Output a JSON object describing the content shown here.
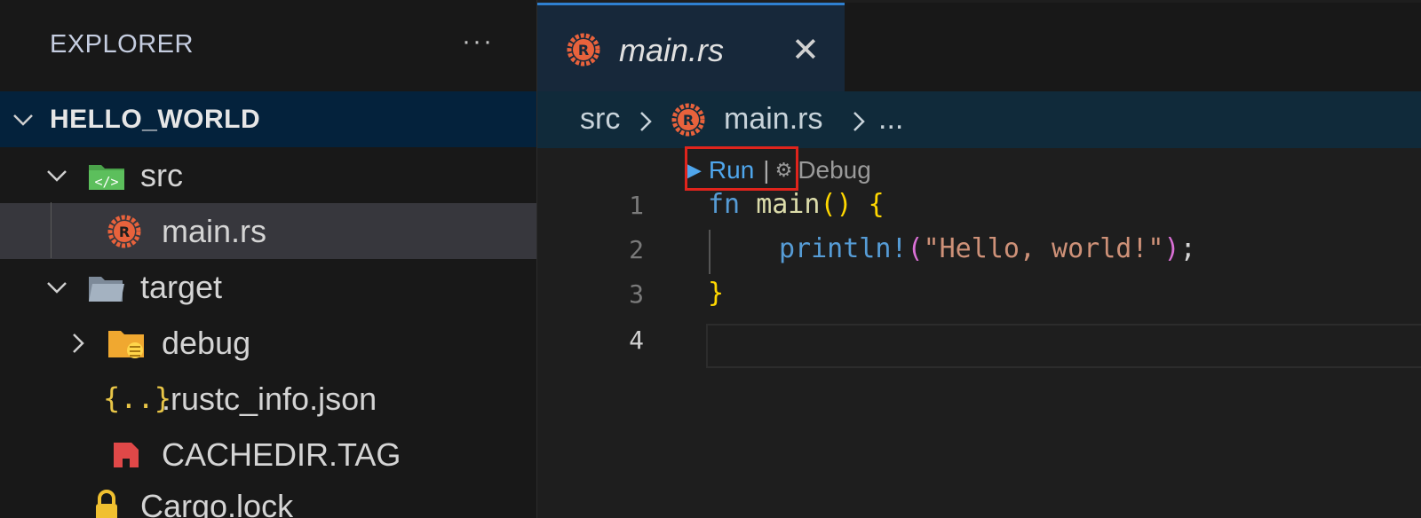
{
  "sidebar": {
    "title": "EXPLORER",
    "more_label": "···",
    "project": "HELLO_WORLD",
    "items": [
      {
        "label": "src",
        "icon": "folder-src-icon",
        "expanded": true
      },
      {
        "label": "main.rs",
        "icon": "rust-file-icon",
        "selected": true
      },
      {
        "label": "target",
        "icon": "folder-icon",
        "expanded": true
      },
      {
        "label": "debug",
        "icon": "folder-debug-icon",
        "expanded": false
      },
      {
        "label": ".rustc_info.json",
        "icon": "json-icon"
      },
      {
        "label": "CACHEDIR.TAG",
        "icon": "tag-file-icon"
      },
      {
        "label": "Cargo.lock",
        "icon": "lock-icon"
      }
    ]
  },
  "editor": {
    "tab": {
      "title": "main.rs",
      "close": "✕"
    },
    "breadcrumb": {
      "folder": "src",
      "file": "main.rs",
      "rest": "..."
    },
    "codelens": {
      "run": "Run",
      "separator": "|",
      "debug": "Debug"
    },
    "line_numbers": [
      "1",
      "2",
      "3",
      "4"
    ],
    "code": {
      "line1_kw": "fn",
      "line1_name": "main",
      "line1_parens": "()",
      "line1_brace": "{",
      "line2_macro": "println!",
      "line2_open": "(",
      "line2_str": "\"Hello, world!\"",
      "line2_close": ")",
      "line2_semi": ";",
      "line3_brace": "}"
    }
  },
  "colors": {
    "accent": "#2f80d0",
    "highlight_box": "#e0241c",
    "rust_orange": "#e8623c"
  }
}
